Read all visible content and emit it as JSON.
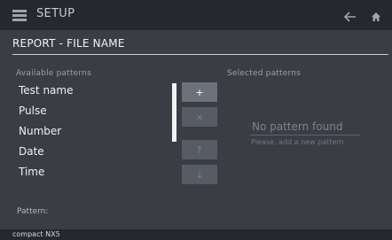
{
  "header": {
    "title": "SETUP",
    "menu_icon": "hamburger-icon",
    "back_icon": "arrow-left-icon",
    "home_icon": "home-icon"
  },
  "page": {
    "title": "REPORT - FILE NAME"
  },
  "available": {
    "header": "Available patterns",
    "items": [
      "Test name",
      "Pulse",
      "Number",
      "Date",
      "Time"
    ]
  },
  "actions": {
    "add": "+",
    "remove": "×",
    "move_up": "↑",
    "move_down": "↓"
  },
  "selected": {
    "header": "Selected patterns",
    "empty_message": "No pattern found",
    "empty_hint": "Please, add a new pattern"
  },
  "pattern": {
    "label": "Pattern:"
  },
  "statusbar": {
    "device": "compact NX5"
  },
  "colors": {
    "background": "#3b3d45",
    "bar": "#25282f",
    "text": "#eef0f3",
    "muted": "#9aa0a8"
  }
}
